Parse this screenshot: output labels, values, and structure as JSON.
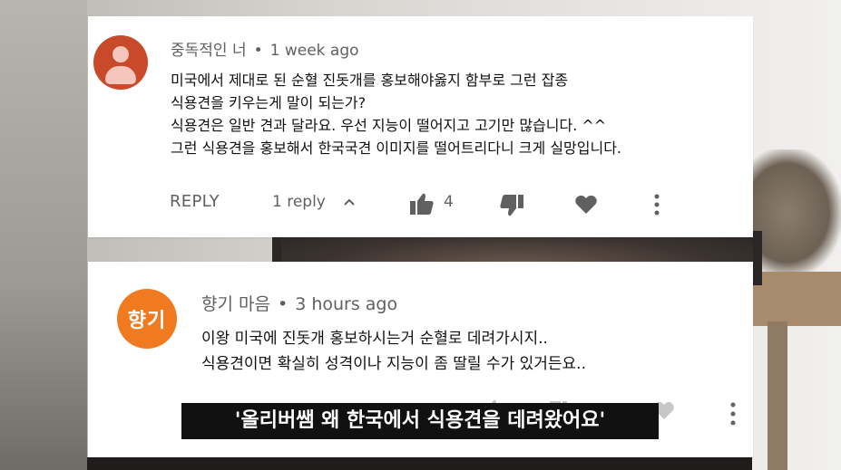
{
  "comments": [
    {
      "author": "중독적인 너",
      "time": "1 week ago",
      "lines": [
        "미국에서 제대로 된 순혈 진돗개를 홍보해야옳지 함부로 그런 잡종",
        "식용견을 키우는게 말이 되는가?",
        "식용견은 일반 견과 달라요. 우선 지능이 떨어지고 고기만 많습니다. ^^",
        "그런 식용견을 홍보해서 한국국견 이미지를 떨어트리다니 크게 실망입니다."
      ],
      "reply_label": "REPLY",
      "replies_label": "1 reply",
      "like_count": "4",
      "avatar_icon": "default-user-icon",
      "avatar_color": "#c94a2b"
    },
    {
      "author": "향기 마음",
      "time": "3 hours ago",
      "avatar_text": "향기",
      "avatar_color": "#f07a1f",
      "lines": [
        "이왕 미국에 진돗개 홍보하시는거 순혈로 데려가시지..",
        "식용견이면 확실히 성격이나 지능이 좀 딸릴 수가 있거든요.."
      ]
    }
  ],
  "subtitle": "'올리버쌤 왜 한국에서 식용견을 데려왔어요'",
  "icons": [
    "chevron-up-icon",
    "thumbs-up-icon",
    "thumbs-down-icon",
    "heart-icon",
    "more-vert-icon"
  ]
}
